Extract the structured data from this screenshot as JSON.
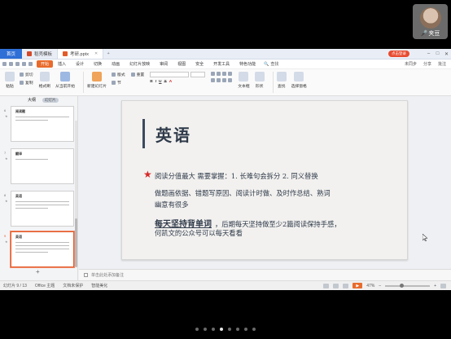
{
  "participant": {
    "name": "夹豆"
  },
  "pager": {
    "count": 8,
    "active_index": 3
  },
  "tabs": {
    "home": "首页",
    "docs": [
      {
        "label": "稻壳模板",
        "active": false
      },
      {
        "label": "考研.pptx",
        "active": true
      }
    ],
    "login": "点击登录"
  },
  "menu": {
    "items": [
      "开始",
      "插入",
      "设计",
      "切换",
      "动画",
      "幻灯片放映",
      "审阅",
      "视图",
      "安全",
      "开发工具",
      "特色功能"
    ],
    "active": "开始",
    "search": "查找",
    "right": [
      "未同步",
      "分享",
      "批注"
    ]
  },
  "ribbon": {
    "paste": "粘贴",
    "cut": "剪切",
    "copy": "复制",
    "format_painter": "格式刷",
    "play_from_current": "从当前开始",
    "new_slide": "新建幻灯片",
    "layout": "版式",
    "section": "节",
    "reset": "重置",
    "textbox": "文本框",
    "shapes": "形状",
    "find": "查找",
    "select_pane": "选择窗格"
  },
  "panel": {
    "tab_outline": "大纲",
    "tab_slides": "幻灯片",
    "thumbnails": [
      {
        "num": "6",
        "title": "阅读题"
      },
      {
        "num": "7",
        "title": "翻译"
      },
      {
        "num": "8",
        "title": "英语"
      },
      {
        "num": "9",
        "title": "英语"
      }
    ],
    "selected_index": 3
  },
  "slide": {
    "title": "英语",
    "line1": "阅读分值最大 需要掌握：1. 长难句会拆分 2. 同义替换",
    "line2": "做题画依据、错题写原因、阅读计时做、及时作总结、熟词",
    "line3": "幽意有很多",
    "line4_emph": "每天坚持背单词",
    "line4_rest": "，后期每天坚持做至少2篇阅读保持手感，",
    "line5": "何凯文的公众号可以每天看看"
  },
  "notes": {
    "placeholder": "单击此处添加备注"
  },
  "status": {
    "slide_indicator": "幻灯片 9 / 13",
    "theme": "Office 主题",
    "protection": "文档未保护",
    "beautify": "智能美化",
    "zoom": "47%"
  }
}
